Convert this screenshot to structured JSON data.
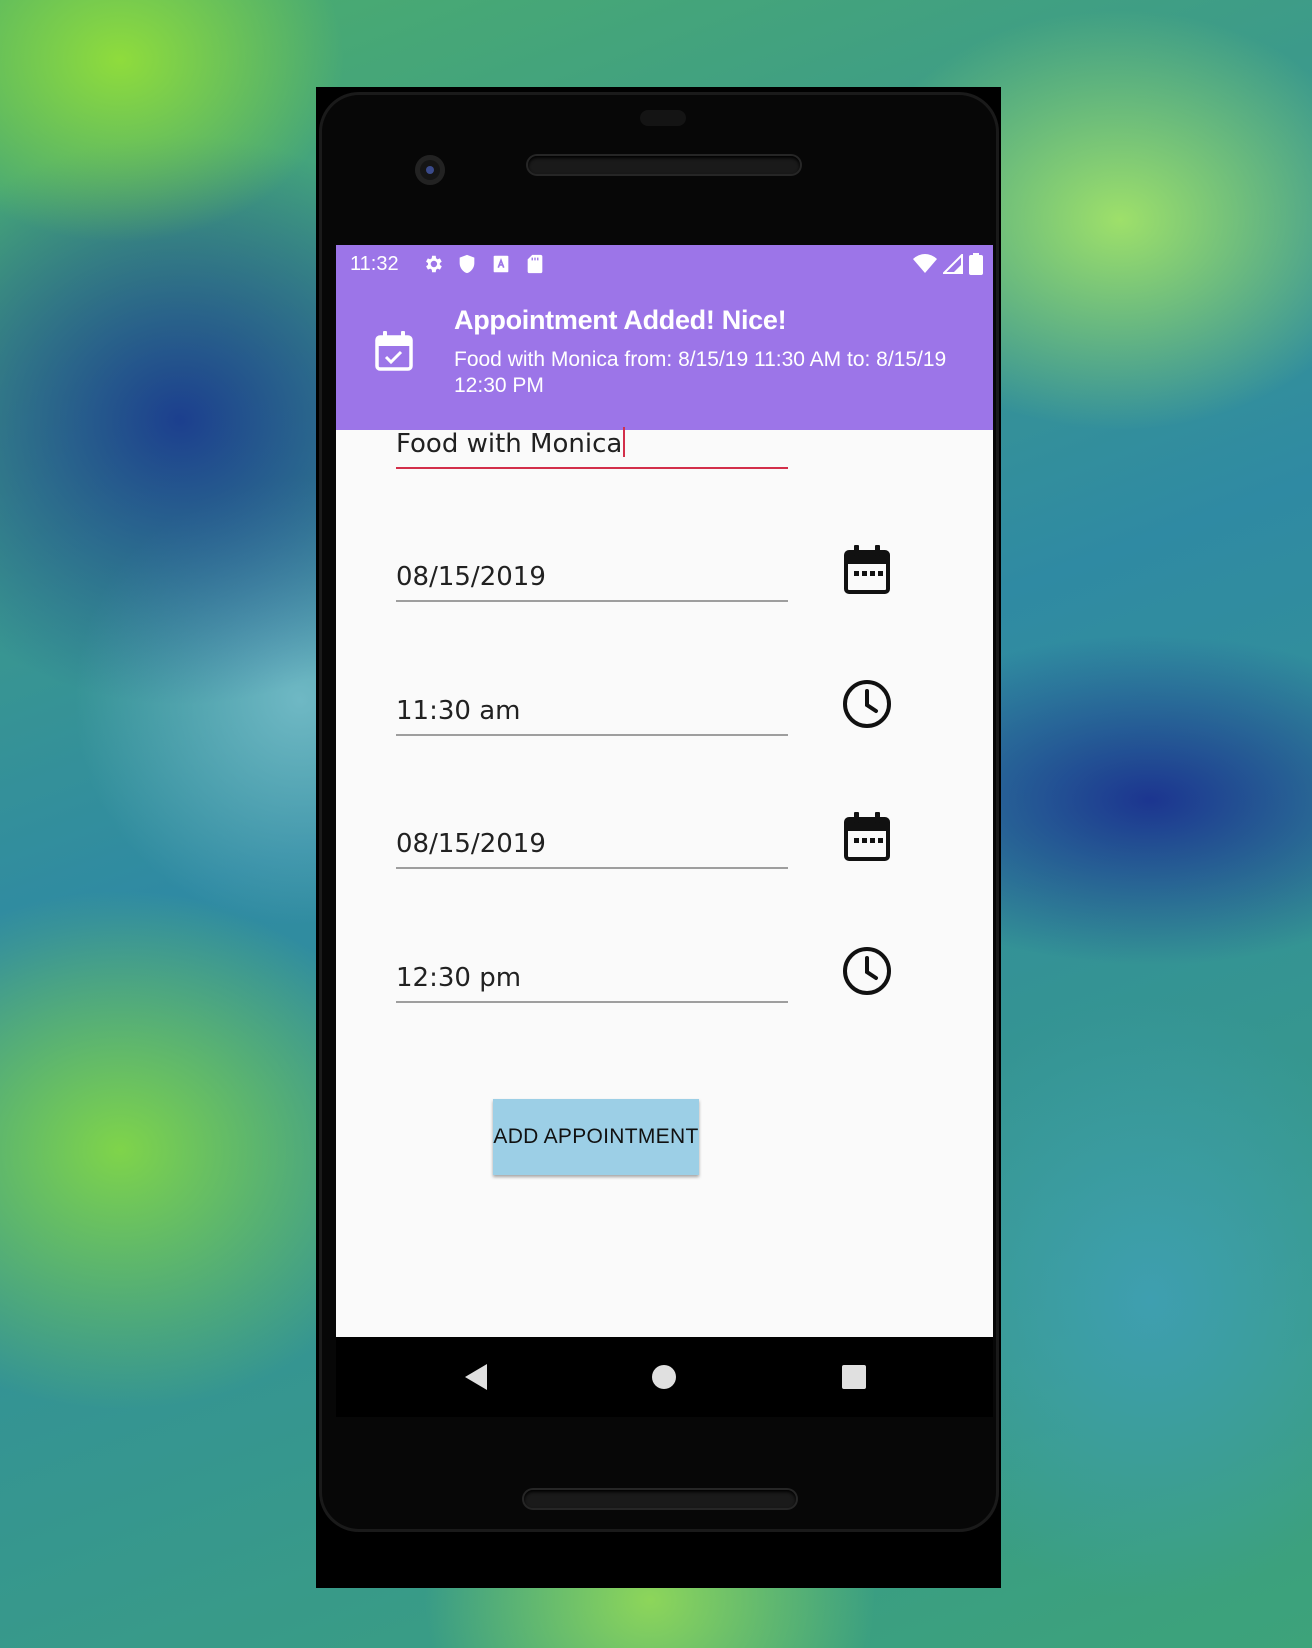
{
  "status_bar": {
    "time": "11:32",
    "icons": [
      "gear-icon",
      "shield-icon",
      "a-box-icon",
      "sd-card-icon",
      "wifi-icon",
      "signal-icon",
      "battery-icon"
    ],
    "color": "#9c75e8"
  },
  "notification": {
    "title": "Appointment Added! Nice!",
    "body": "Food with Monica from: 8/15/19 11:30 AM to: 8/15/19 12:30 PM",
    "icon": "calendar-check-icon"
  },
  "form": {
    "title_value": "Food with Monica",
    "start_date": "08/15/2019",
    "start_time": "11:30 am",
    "end_date": "08/15/2019",
    "end_time": "12:30 pm",
    "add_button_label": "ADD APPOINTMENT"
  },
  "colors": {
    "accent_underline": "#d32f4a",
    "button": "#9ccfe6"
  }
}
